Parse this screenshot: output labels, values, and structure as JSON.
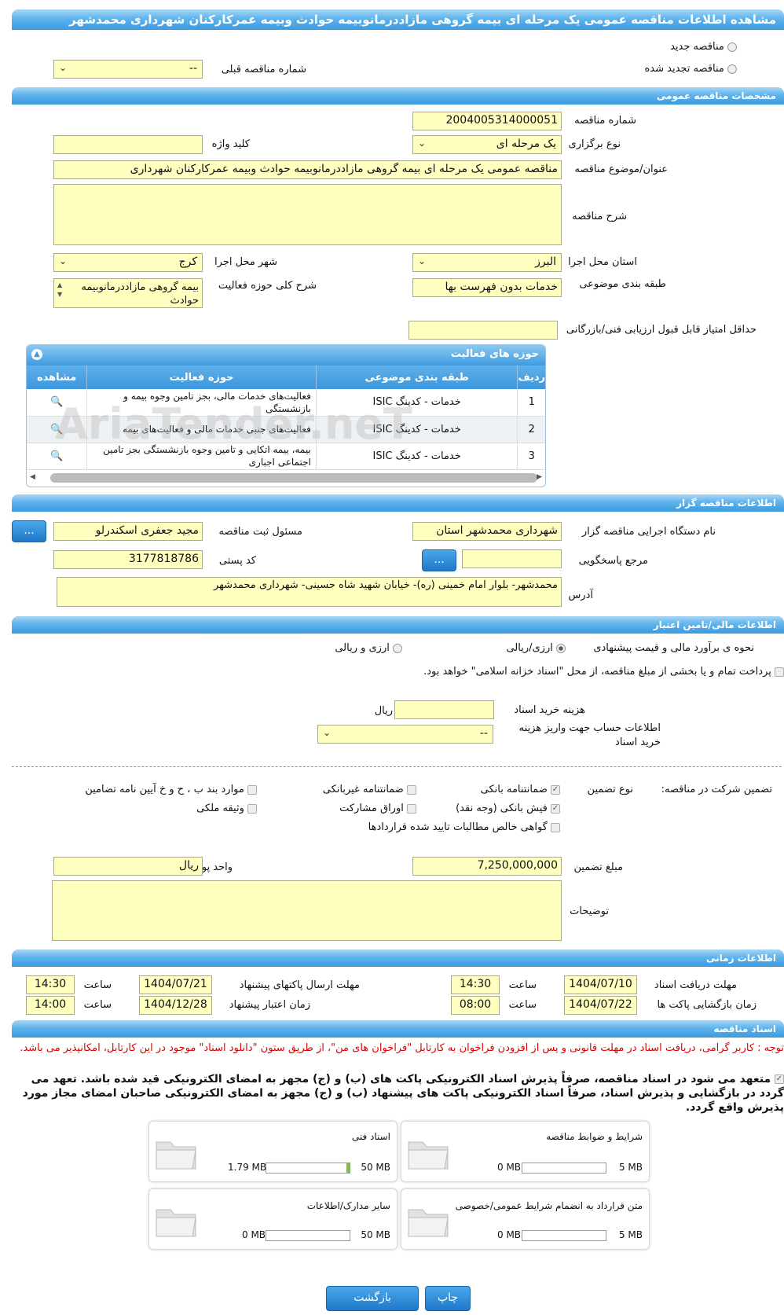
{
  "page": {
    "title": "مشاهده اطلاعات مناقصه عمومی یک مرحله ای بیمه گروهی مازاددرمانوبیمه حوادث وبیمه عمرکارکنان شهرداری محمدشهر"
  },
  "top": {
    "radio_new": "مناقصه جدید",
    "radio_renew": "مناقصه تجدید شده",
    "prev_number_label": "شماره مناقصه قبلی",
    "prev_number_value": "--"
  },
  "general": {
    "header": "مشخصات مناقصه عمومی",
    "number_label": "شماره مناقصه",
    "number_value": "2004005314000051",
    "type_label": "نوع برگزاری",
    "type_value": "یک مرحله ای",
    "keyword_label": "کلید واژه",
    "keyword_value": "",
    "title_label": "عنوان/موضوع مناقصه",
    "title_value": "مناقصه عمومی یک مرحله ای بیمه گروهی مازاددرمانوبیمه حوادث وبیمه عمرکارکنان شهرداری",
    "desc_label": "شرح مناقصه",
    "desc_value": "",
    "province_label": "استان محل اجرا",
    "province_value": "البرز",
    "city_label": "شهر محل اجرا",
    "city_value": "کرج",
    "category_label": "طبقه بندی موضوعی",
    "category_value": "خدمات بدون فهرست بها",
    "activity_desc_label": "شرح کلی حوزه فعالیت",
    "activity_desc_value": "بیمه گروهی مازاددرمانوبیمه حوادث",
    "min_score_label": "حداقل امتیاز قابل قبول ارزیابی فنی/بازرگانی",
    "min_score_value": ""
  },
  "activities": {
    "header": "حوزه های فعالیت",
    "columns": [
      "ردیف",
      "طبقه بندی موضوعی",
      "حوزه فعالیت",
      "مشاهده"
    ],
    "rows": [
      {
        "num": "1",
        "category": "خدمات - کدینگ ISIC",
        "activity": "فعالیت‌های خدمات مالی، بجز تامین وجوه بیمه و بازنشستگی"
      },
      {
        "num": "2",
        "category": "خدمات - کدینگ ISIC",
        "activity": "فعالیت‌های جنبی خدمات مالی و فعالیت‌های بیمه"
      },
      {
        "num": "3",
        "category": "خدمات - کدینگ ISIC",
        "activity": "بیمه، بیمه اتکایی و تامین وجوه بازنشستگی بجز تامین اجتماعی اجباری"
      }
    ],
    "watermark": "AriaTender.neT"
  },
  "organizer": {
    "header": "اطلاعات مناقصه گزار",
    "org_label": "نام دستگاه اجرایی مناقصه گزار",
    "org_value": "شهرداری محمدشهر استان",
    "resp_label": "مسئول ثبت مناقصه",
    "resp_value": "مجید جعفری اسکندرلو",
    "ref_label": "مرجع پاسخگویی",
    "ref_value": "",
    "postal_label": "کد پستی",
    "postal_value": "3177818786",
    "address_label": "آدرس",
    "address_value": "محمدشهر- بلوار امام خمینی (ره)- خیابان شهید شاه حسینی- شهرداری محمدشهر",
    "dots": "..."
  },
  "finance": {
    "header": "اطلاعات مالی/تامین اعتبار",
    "estimate_label": "نحوه ی برآورد مالی و قیمت پیشنهادی",
    "opt_rial": "ارزی/ریالی",
    "opt_both": "ارزی و ریالی",
    "islamic_text": "پرداخت تمام و یا بخشی از مبلغ مناقصه، از محل \"اسناد خزانه اسلامی\" خواهد بود.",
    "doc_cost_label": "هزینه خرید اسناد",
    "doc_cost_unit": "ریال",
    "account_label": "اطلاعات حساب جهت واریز هزینه خرید اسناد",
    "account_value": "--",
    "guarantee_label": "تضمین شرکت در مناقصه:",
    "guarantee_type_label": "نوع تضمین",
    "g_bank": "ضمانتنامه بانکی",
    "g_nonbank": "ضمانتنامه غیربانکی",
    "g_articles": "موارد بند ب ، ح و خ آیین نامه تضامین",
    "g_cash": "فیش بانکی (وجه نقد)",
    "g_bonds": "اوراق مشارکت",
    "g_property": "وثیقه ملکی",
    "g_claims": "گواهی خالص مطالبات تایید شده قراردادها",
    "amount_label": "مبلغ تضمین",
    "amount_value": "7,250,000,000",
    "currency_label": "واحد پول",
    "currency_value": "ریال",
    "notes_label": "توضیحات"
  },
  "timing": {
    "header": "اطلاعات زمانی",
    "receive_label": "مهلت دریافت اسناد",
    "receive_date": "1404/07/10",
    "receive_time": "14:30",
    "send_label": "مهلت ارسال پاکتهای پیشنهاد",
    "send_date": "1404/07/21",
    "send_time": "14:30",
    "open_label": "زمان بازگشایی پاکت ها",
    "open_date": "1404/07/22",
    "open_time": "08:00",
    "valid_label": "زمان اعتبار پیشنهاد",
    "valid_date": "1404/12/28",
    "valid_time": "14:00",
    "time_label": "ساعت"
  },
  "docs": {
    "header": "اسناد مناقصه",
    "notice": "توجه : کاربر گرامی، دریافت اسناد در مهلت قانونی و پس از افزودن فراخوان به کارتابل \"فراخوان های من\"، از طریق ستون \"دانلود اسناد\" موجود در این کارتابل، امکانپذیر می باشد.",
    "commit": "متعهد می شود در اسناد مناقصه، صرفاً پذیرش اسناد الکترونیکی پاکت های (ب) و (ج) مجهز به امضای الکترونیکی قید شده باشد. تعهد می گردد در بازگشایی و پذیرش اسناد، صرفاً اسناد الکترونیکی پاکت های پیشنهاد (ب) و (ج) مجهز به امضای الکترونیکی صاحبان امضای مجاز مورد پذیرش واقع گردد.",
    "cards": [
      {
        "title": "شرایط و ضوابط مناقصه",
        "used": "0 MB",
        "max": "5 MB",
        "fraction": 0
      },
      {
        "title": "اسناد فنی",
        "used": "1.79 MB",
        "max": "50 MB",
        "fraction": 0.036
      },
      {
        "title": "متن قرارداد به انضمام شرایط عمومی/خصوصی",
        "used": "0 MB",
        "max": "5 MB",
        "fraction": 0
      },
      {
        "title": "سایر مدارک/اطلاعات",
        "used": "0 MB",
        "max": "50 MB",
        "fraction": 0
      }
    ]
  },
  "footer": {
    "print": "چاپ",
    "back": "بازگشت"
  }
}
